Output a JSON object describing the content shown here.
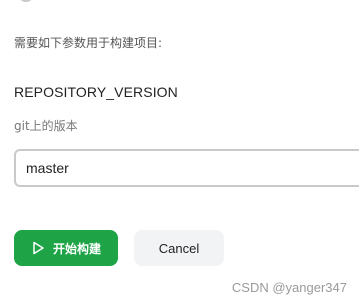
{
  "form": {
    "intro_text": "需要如下参数用于构建项目:",
    "parameter": {
      "name": "REPOSITORY_VERSION",
      "description": "git上的版本",
      "value": "master"
    },
    "build_button_label": "开始构建",
    "cancel_button_label": "Cancel"
  },
  "watermark": "CSDN @yanger347",
  "icons": {
    "build": "play-icon"
  },
  "colors": {
    "build_button": "#1ea446",
    "cancel_button_bg": "#f2f3f5",
    "field_border": "#c9c9c9"
  }
}
